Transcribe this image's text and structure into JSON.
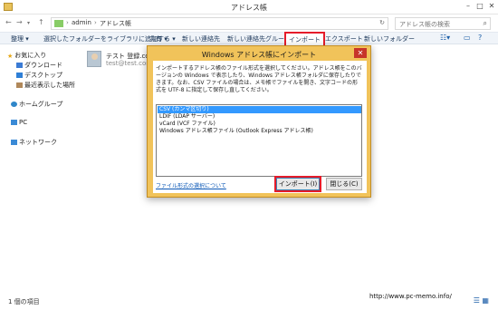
{
  "window": {
    "title": "アドレス帳"
  },
  "address_bar": {
    "breadcrumb": [
      "admin",
      "アドレス帳"
    ],
    "search_placeholder": "アドレス帳の検索"
  },
  "toolbar": {
    "items": [
      "整理 ▾",
      "選択したフォルダーをライブラリに追加する ▾",
      "共有 ▾",
      "新しい連絡先",
      "新しい連絡先グループ",
      "インポート",
      "エクスポート",
      "新しいフォルダー"
    ]
  },
  "nav": {
    "favorites_label": "お気に入り",
    "favorites": [
      "ダウンロード",
      "デスクトップ",
      "最近表示した場所"
    ],
    "homegroup": "ホームグループ",
    "pc": "PC",
    "network": "ネットワーク"
  },
  "content": {
    "contact_name": "テスト 登録.con",
    "contact_email": "test@test.com"
  },
  "status": {
    "item_count": "1 個の項目",
    "watermark_url": "http://www.pc-memo.info/"
  },
  "dialog": {
    "title": "Windows アドレス帳にインポート",
    "description": "インポートするアドレス帳のファイル形式を選択してください。アドレス帳をこのバージョンの Windows で表示したり、Windows アドレス帳フォルダに保存したりできます。なお、CSV ファイルの場合は、メモ帳でファイルを開き、文字コードの形式を UTF-8 に指定して保存し直してください。",
    "options": [
      "CSV (カンマ区切り)",
      "LDIF (LDAP サーバー)",
      "vCard (VCF ファイル)",
      "Windows アドレス帳ファイル (Outlook Express アドレス帳)"
    ],
    "selected_index": 0,
    "help_link": "ファイル形式の選択について",
    "import_button": "インポート(I)",
    "close_button": "閉じる(C)"
  }
}
